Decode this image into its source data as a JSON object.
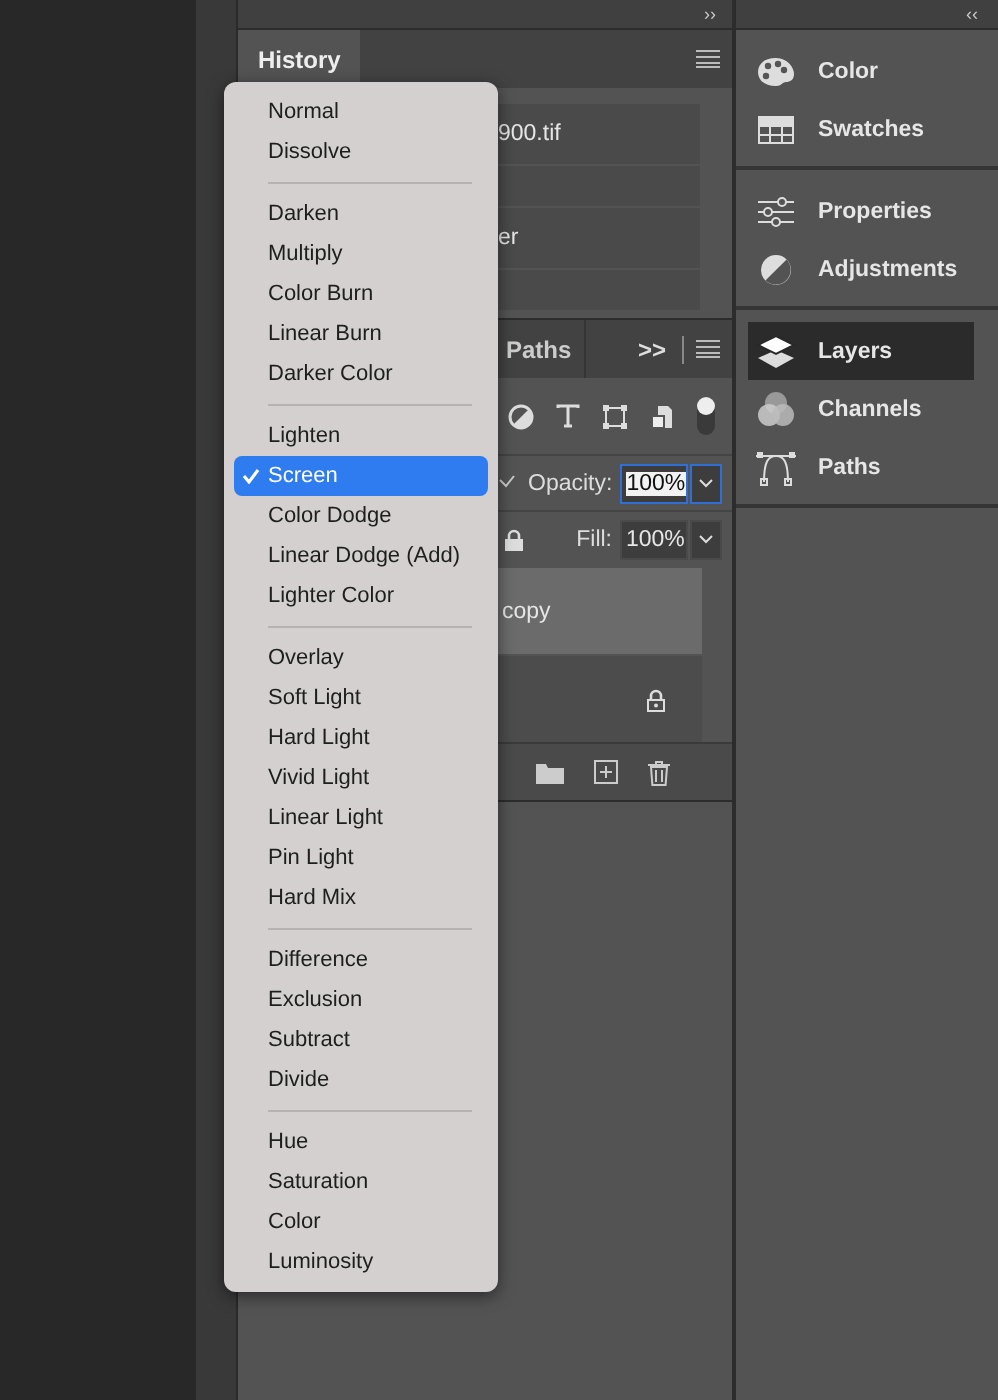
{
  "history_panel": {
    "collapse_glyph": "››",
    "tab": {
      "label": "History",
      "selected": true
    },
    "rows": [
      {
        "label": "900.tif"
      },
      {
        "selected": false
      },
      {
        "label": "er"
      },
      {
        "selected": false
      }
    ]
  },
  "layers_panel": {
    "tabs": [
      {
        "label": "Paths",
        "selected": false
      }
    ],
    "collapse_glyph": ">>",
    "opacity_label": "Opacity:",
    "opacity": "100%",
    "fill_label": "Fill:",
    "fill": "100%",
    "layers": [
      {
        "name": "copy",
        "selected": true,
        "locked": false
      },
      {
        "selected": false,
        "locked": true
      }
    ]
  },
  "blend_menu": {
    "groups": [
      [
        {
          "label": "Normal",
          "selected": false
        },
        {
          "label": "Dissolve",
          "selected": false
        }
      ],
      [
        {
          "label": "Darken",
          "selected": false
        },
        {
          "label": "Multiply",
          "selected": false
        },
        {
          "label": "Color Burn",
          "selected": false
        },
        {
          "label": "Linear Burn",
          "selected": false
        },
        {
          "label": "Darker Color",
          "selected": false
        }
      ],
      [
        {
          "label": "Lighten",
          "selected": false
        },
        {
          "label": "Screen",
          "selected": true
        },
        {
          "label": "Color Dodge",
          "selected": false
        },
        {
          "label": "Linear Dodge (Add)",
          "selected": false
        },
        {
          "label": "Lighter Color",
          "selected": false
        }
      ],
      [
        {
          "label": "Overlay",
          "selected": false
        },
        {
          "label": "Soft Light",
          "selected": false
        },
        {
          "label": "Hard Light",
          "selected": false
        },
        {
          "label": "Vivid Light",
          "selected": false
        },
        {
          "label": "Linear Light",
          "selected": false
        },
        {
          "label": "Pin Light",
          "selected": false
        },
        {
          "label": "Hard Mix",
          "selected": false
        }
      ],
      [
        {
          "label": "Difference",
          "selected": false
        },
        {
          "label": "Exclusion",
          "selected": false
        },
        {
          "label": "Subtract",
          "selected": false
        },
        {
          "label": "Divide",
          "selected": false
        }
      ],
      [
        {
          "label": "Hue",
          "selected": false
        },
        {
          "label": "Saturation",
          "selected": false
        },
        {
          "label": "Color",
          "selected": false
        },
        {
          "label": "Luminosity",
          "selected": false
        }
      ]
    ]
  },
  "dock": {
    "expand_glyph": "‹‹",
    "groups": [
      [
        {
          "label": "Color",
          "kind": "palette",
          "selected": false
        },
        {
          "label": "Swatches",
          "kind": "grid",
          "selected": false
        }
      ],
      [
        {
          "label": "Properties",
          "kind": "sliders",
          "selected": false
        },
        {
          "label": "Adjustments",
          "kind": "halfcircle",
          "selected": false
        }
      ],
      [
        {
          "label": "Layers",
          "kind": "layers",
          "selected": true
        },
        {
          "label": "Channels",
          "kind": "circles",
          "selected": false
        },
        {
          "label": "Paths",
          "kind": "pen",
          "selected": false
        }
      ]
    ]
  }
}
